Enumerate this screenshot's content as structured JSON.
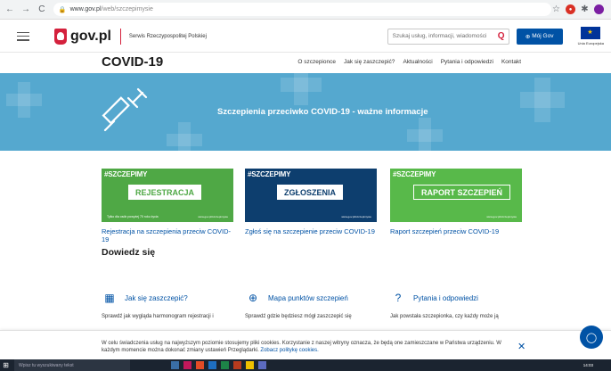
{
  "browser": {
    "url_host": "www.gov.pl",
    "url_path": "/web/szczepimysie",
    "back": "←",
    "forward": "→",
    "reload": "C"
  },
  "header": {
    "logo_text": "gov.pl",
    "service_name": "Serwis Rzeczypospolitej Polskiej",
    "search_placeholder": "Szukaj usług, informacji, wiadomości",
    "account_button": "Mój Gov",
    "eu_label": "Unia Europejska"
  },
  "page": {
    "title": "COVID-19",
    "nav": [
      "O szczepionce",
      "Jak się zaszczepić?",
      "Aktualności",
      "Pytania i odpowiedzi",
      "Kontakt"
    ]
  },
  "banner": {
    "title": "Szczepienia przeciwko COVID-19 - ważne informacje"
  },
  "cards": [
    {
      "tag": "#SZCZEPIMY",
      "button": "REJESTRACJA",
      "note": "Tylko dla osób powyżej 70 roku życia",
      "url": "www.gov.pl/szczepimysie",
      "link": "Rejestracja na szczepienia przeciw COVID-19",
      "color": "#4fa845"
    },
    {
      "tag": "#SZCZEPIMY",
      "button": "ZGŁOSZENIA",
      "note": "",
      "url": "www.gov.pl/szczepimysie",
      "link": "Zgłoś się na szczepienie przeciw COVID-19",
      "color": "#0d3e6e"
    },
    {
      "tag": "#SZCZEPIMY",
      "button": "RAPORT SZCZEPIEŃ",
      "note": "",
      "url": "www.gov.pl/szczepimysie",
      "link": "Raport szczepień przeciw COVID-19",
      "color": "#58b94a"
    }
  ],
  "learn": {
    "title": "Dowiedz się",
    "items": [
      {
        "label": "Jak się zaszczepić?",
        "desc": "Sprawdź jak wygląda harmonogram rejestracji i",
        "icon": "calendar-icon"
      },
      {
        "label": "Mapa punktów szczepień",
        "desc": "Sprawdź gdzie będziesz mógł zaszczepić się",
        "icon": "map-pin-icon"
      },
      {
        "label": "Pytania i odpowiedzi",
        "desc": "Jak powstała szczepionka, czy każdy może ją",
        "icon": "faq-icon"
      }
    ]
  },
  "cookie": {
    "text": "W celu świadczenia usług na najwyższym poziomie stosujemy pliki cookies. Korzystanie z naszej witryny oznacza, że będą one zamieszczane w Państwa urządzeniu. W każdym momencie można dokonać zmiany ustawień Przeglądarki.",
    "link": "Zobacz politykę cookies.",
    "close": "✕"
  },
  "taskbar": {
    "search_placeholder": "Wpisz tu wyszukiwany tekst",
    "time": "14:03"
  },
  "colors": {
    "brand_red": "#d4213d",
    "brand_blue": "#0052a5",
    "banner_blue": "#55a8cf"
  }
}
